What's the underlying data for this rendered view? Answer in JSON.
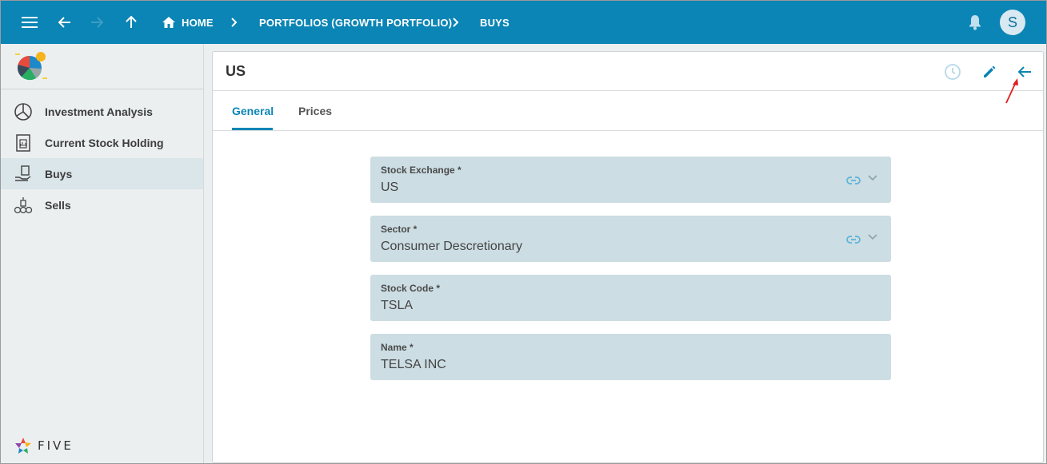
{
  "topbar": {
    "breadcrumbs": [
      "HOME",
      "PORTFOLIOS (GROWTH PORTFOLIO)",
      "BUYS"
    ],
    "avatar_letter": "S"
  },
  "sidebar": {
    "items": [
      {
        "label": "Investment Analysis",
        "icon": "pie-chart-icon"
      },
      {
        "label": "Current Stock Holding",
        "icon": "document-icon"
      },
      {
        "label": "Buys",
        "icon": "hand-money-icon"
      },
      {
        "label": "Sells",
        "icon": "coins-icon"
      }
    ],
    "active_index": 2,
    "footer_brand": "FIVE"
  },
  "record": {
    "title": "US",
    "tabs": [
      {
        "label": "General",
        "active": true
      },
      {
        "label": "Prices",
        "active": false
      }
    ],
    "fields": [
      {
        "label": "Stock Exchange *",
        "value": "US",
        "lookup": true
      },
      {
        "label": "Sector *",
        "value": "Consumer Descretionary",
        "lookup": true
      },
      {
        "label": "Stock Code *",
        "value": "TSLA",
        "lookup": false
      },
      {
        "label": "Name *",
        "value": "TELSA INC",
        "lookup": false
      }
    ]
  },
  "colors": {
    "primary": "#0b85b5",
    "field_bg": "#ccdde3",
    "sidebar_bg": "#eceff0",
    "annotation": "#e02020"
  }
}
